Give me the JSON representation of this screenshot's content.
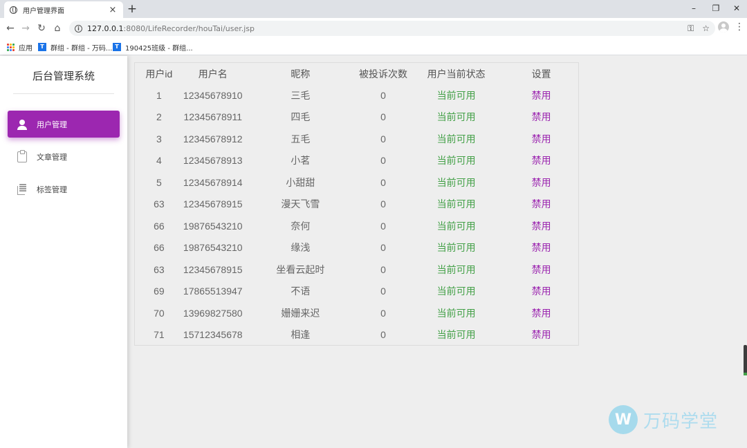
{
  "browser": {
    "tab_title": "用户管理界面",
    "tab_close": "×",
    "new_tab": "+",
    "url_host": "127.0.0.1",
    "url_path": ":8080/LifeRecorder/houTai/user.jsp",
    "info_icon": "i",
    "window_controls": {
      "minimize": "–",
      "restore": "❐",
      "close": "✕"
    },
    "nav": {
      "back": "←",
      "forward": "→",
      "reload": "↻",
      "home": "⌂"
    },
    "key_icon": "⚿",
    "star_icon": "☆",
    "menu_icon": "⋮",
    "bookmarks": [
      {
        "label": "应用",
        "icon": "apps-grid"
      },
      {
        "label": "群组 - 群组 - 万码...",
        "icon": "T"
      },
      {
        "label": "190425班级 - 群组...",
        "icon": "T"
      }
    ]
  },
  "sidebar": {
    "brand": "后台管理系统",
    "items": [
      {
        "label": "用户管理",
        "icon": "person-icon",
        "active": true
      },
      {
        "label": "文章管理",
        "icon": "clipboard-icon",
        "active": false
      },
      {
        "label": "标签管理",
        "icon": "library-icon",
        "active": false
      }
    ]
  },
  "table": {
    "headers": [
      "用户id",
      "用户名",
      "昵称",
      "被投诉次数",
      "用户当前状态",
      "设置"
    ],
    "rows": [
      {
        "id": "1",
        "username": "12345678910",
        "nickname": "三毛",
        "complaints": "0",
        "status": "当前可用",
        "action": "禁用"
      },
      {
        "id": "2",
        "username": "12345678911",
        "nickname": "四毛",
        "complaints": "0",
        "status": "当前可用",
        "action": "禁用"
      },
      {
        "id": "3",
        "username": "12345678912",
        "nickname": "五毛",
        "complaints": "0",
        "status": "当前可用",
        "action": "禁用"
      },
      {
        "id": "4",
        "username": "12345678913",
        "nickname": "小茗",
        "complaints": "0",
        "status": "当前可用",
        "action": "禁用"
      },
      {
        "id": "5",
        "username": "12345678914",
        "nickname": "小甜甜",
        "complaints": "0",
        "status": "当前可用",
        "action": "禁用"
      },
      {
        "id": "63",
        "username": "12345678915",
        "nickname": "漫天飞雪",
        "complaints": "0",
        "status": "当前可用",
        "action": "禁用"
      },
      {
        "id": "66",
        "username": "19876543210",
        "nickname": "奈何",
        "complaints": "0",
        "status": "当前可用",
        "action": "禁用"
      },
      {
        "id": "66",
        "username": "19876543210",
        "nickname": "缘浅",
        "complaints": "0",
        "status": "当前可用",
        "action": "禁用"
      },
      {
        "id": "63",
        "username": "12345678915",
        "nickname": "坐看云起时",
        "complaints": "0",
        "status": "当前可用",
        "action": "禁用"
      },
      {
        "id": "69",
        "username": "17865513947",
        "nickname": "不语",
        "complaints": "0",
        "status": "当前可用",
        "action": "禁用"
      },
      {
        "id": "70",
        "username": "13969827580",
        "nickname": "姗姗来迟",
        "complaints": "0",
        "status": "当前可用",
        "action": "禁用"
      },
      {
        "id": "71",
        "username": "15712345678",
        "nickname": "相逢",
        "complaints": "0",
        "status": "当前可用",
        "action": "禁用"
      }
    ]
  },
  "watermark": {
    "logo": "W",
    "text": "万码学堂"
  },
  "colors": {
    "accent": "#9c27b0",
    "status_ok": "#43a047",
    "watermark": "#a8dbee"
  }
}
